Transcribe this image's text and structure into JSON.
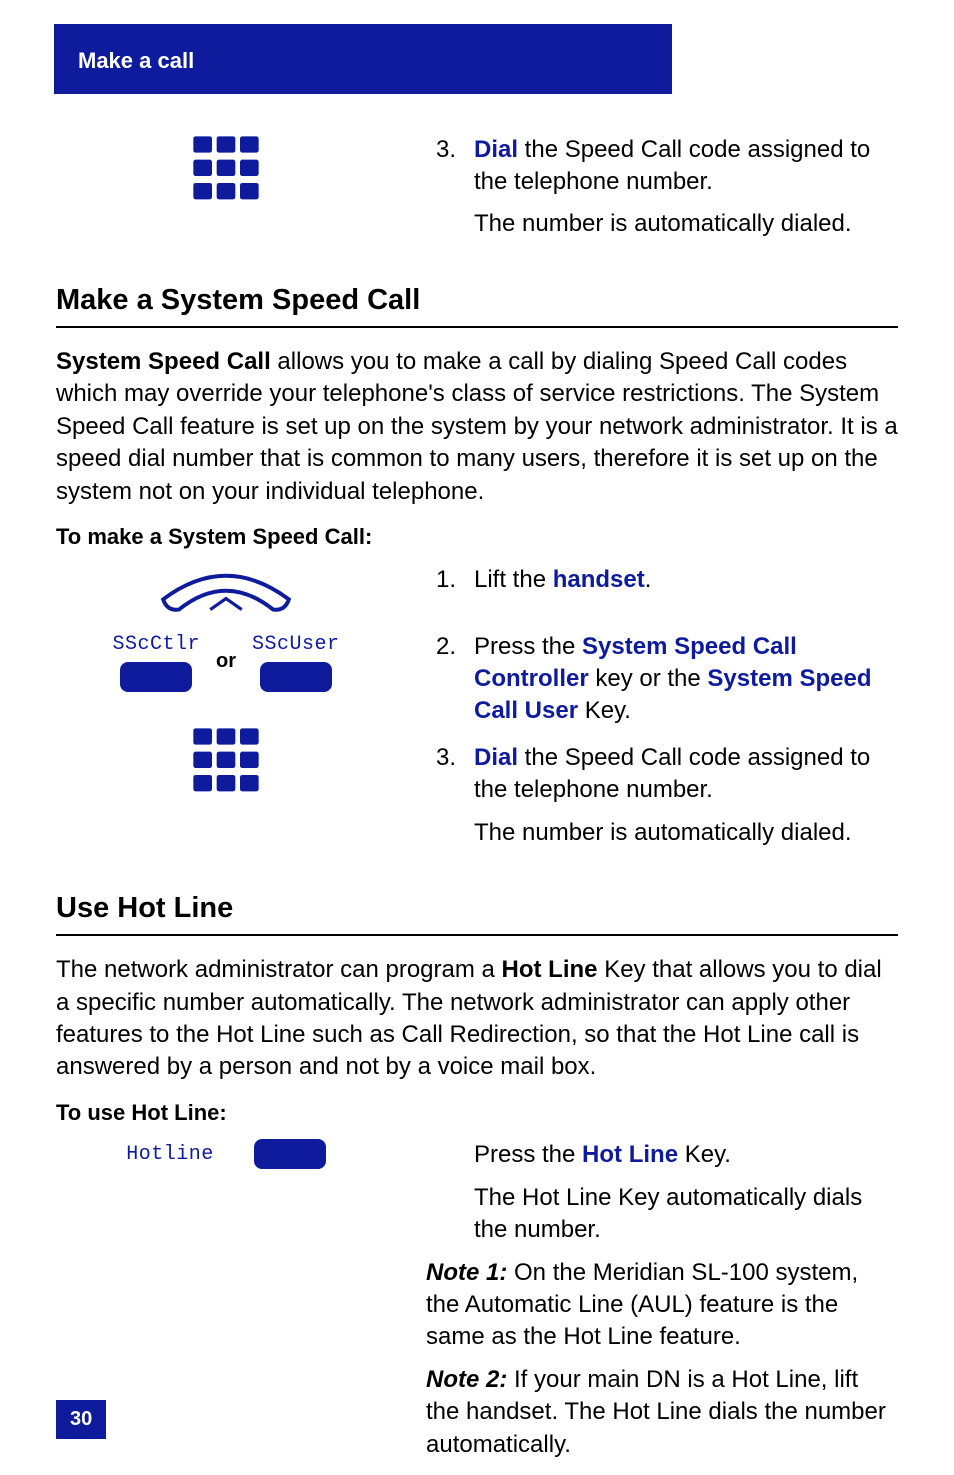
{
  "header": {
    "tab": "Make a call"
  },
  "step_a": {
    "num": "3.",
    "dial_word": "Dial",
    "rest": " the Speed Call code assigned to the telephone number.",
    "sub": "The number is automatically dialed."
  },
  "h_system": "Make a System Speed Call",
  "system_intro_bold": "System Speed Call",
  "system_intro_rest": " allows you to make a call by dialing Speed Call codes which may override your telephone's class of service restrictions. The System Speed Call feature is set up on the system by your network administrator. It is a speed dial number that is common to many users, therefore it is set up on the system not on your individual telephone.",
  "system_to_make": "To make a System Speed Call:",
  "sys_keys": {
    "ctlr": "SScCtlr",
    "user": "SScUser",
    "or": "or"
  },
  "sys_step1": {
    "num": "1.",
    "pre": "Lift the ",
    "hl": "handset",
    "post": "."
  },
  "sys_step2": {
    "num": "2.",
    "pre": "Press the ",
    "hl1": "System Speed Call Controller",
    "mid": " key or the ",
    "hl2": "System Speed Call User",
    "post": " Key."
  },
  "sys_step3": {
    "num": "3.",
    "dial_word": "Dial",
    "rest": " the Speed Call code assigned to the telephone number.",
    "sub": "The number is automatically dialed."
  },
  "h_hotline": "Use Hot Line",
  "hotline_intro_pre": "The network administrator can program a ",
  "hotline_intro_bold": "Hot Line",
  "hotline_intro_post": " Key that allows you to dial a specific number automatically. The network administrator can apply other features to the Hot Line such as Call Redirection, so that the Hot Line call is answered by a person and not by a voice mail box.",
  "hotline_to_use": "To use Hot Line:",
  "hotline_key_label": "Hotline",
  "hotline_step_pre": "Press the ",
  "hotline_step_hl": "Hot Line",
  "hotline_step_post": " Key.",
  "hotline_sub": "The Hot Line Key automatically dials the number.",
  "note1_label": "Note 1:",
  "note1_text": "  On the Meridian SL-100 system, the Automatic Line (AUL) feature is the same as the Hot Line feature.",
  "note2_label": "Note 2:",
  "note2_text": "   If your main DN is a Hot Line, lift the handset. The Hot Line dials the number automatically.",
  "page_number": "30"
}
